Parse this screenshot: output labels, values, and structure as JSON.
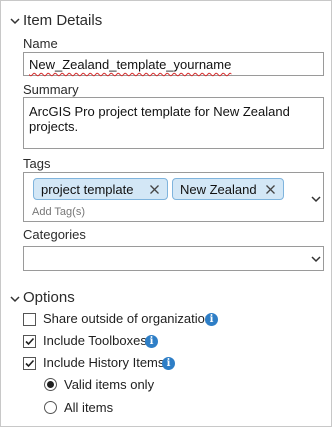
{
  "item_details": {
    "section_title": "Item Details",
    "name_label": "Name",
    "name_value": "New_Zealand_template_yourname",
    "summary_label": "Summary",
    "summary_value": "ArcGIS Pro project template for New Zealand projects.",
    "tags_label": "Tags",
    "tags": [
      "project template",
      "New Zealand"
    ],
    "add_tag_placeholder": "Add Tag(s)",
    "categories_label": "Categories",
    "categories_value": ""
  },
  "options": {
    "section_title": "Options",
    "share_outside": {
      "label": "Share outside of organization",
      "checked": false
    },
    "include_toolboxes": {
      "label": "Include Toolboxes",
      "checked": true
    },
    "include_history": {
      "label": "Include History Items",
      "checked": true
    },
    "history_mode": {
      "options": [
        "Valid items only",
        "All items"
      ],
      "selected": "Valid items only"
    }
  },
  "colors": {
    "tag_fill": "#d3e7f6",
    "tag_border": "#7fb4dd",
    "info_icon": "#2e7ec6"
  }
}
